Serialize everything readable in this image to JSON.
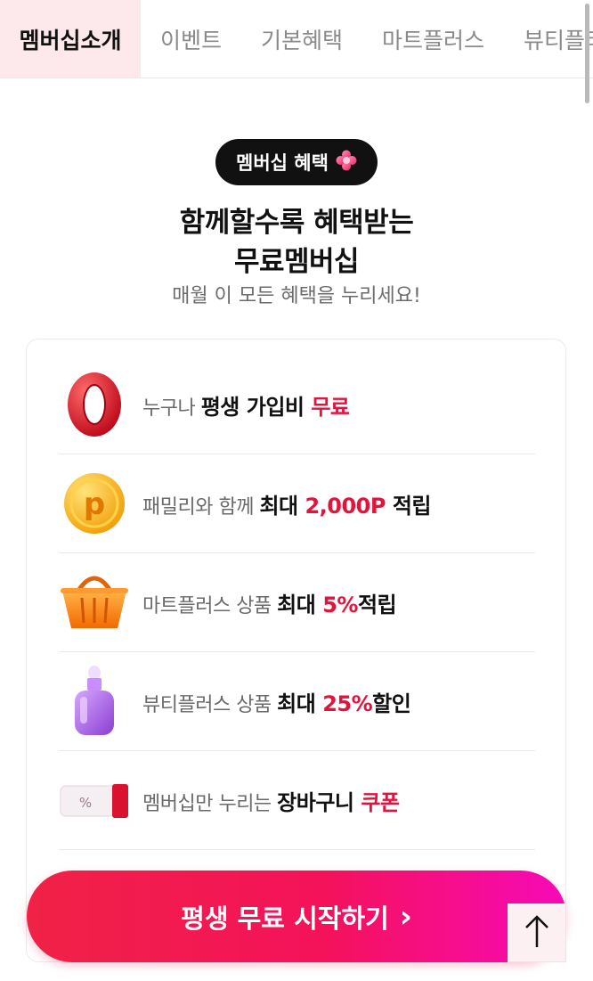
{
  "tabs": [
    {
      "label": "멤버십소개",
      "active": true
    },
    {
      "label": "이벤트",
      "active": false
    },
    {
      "label": "기본혜택",
      "active": false
    },
    {
      "label": "마트플러스",
      "active": false
    },
    {
      "label": "뷰티플러",
      "active": false
    }
  ],
  "hero": {
    "badge": "멤버십 혜택",
    "title_line1": "함께할수록 혜택받는",
    "title_line2": "무료멤버십",
    "subtitle": "매월 이 모든 혜택을 누리세요!"
  },
  "benefits": [
    {
      "icon": "zero-icon",
      "pre": "누구나 ",
      "strong": "평생 가입비 ",
      "red": "무료",
      "post": ""
    },
    {
      "icon": "point-coin-icon",
      "pre": "패밀리와 함께 ",
      "strong": "최대 ",
      "red": "2,000P",
      "post": " 적립"
    },
    {
      "icon": "basket-icon",
      "pre": "마트플러스 상품 ",
      "strong": "최대 ",
      "red": "5%",
      "post": "적립"
    },
    {
      "icon": "serum-bottle-icon",
      "pre": "뷰티플러스 상품 ",
      "strong": "최대 ",
      "red": "25%",
      "post": "할인"
    },
    {
      "icon": "coupon-icon",
      "pre": "멤버십만 누리는 ",
      "strong": "장바구니 ",
      "red": "쿠폰",
      "post": ""
    }
  ],
  "cta": {
    "label": "평생 무료 시작하기",
    "arrow": "›"
  },
  "colors": {
    "accent": "#e4133c",
    "cta_start": "#f02246",
    "cta_end": "#f70ab8",
    "tab_active_bg": "#fde9ec"
  }
}
